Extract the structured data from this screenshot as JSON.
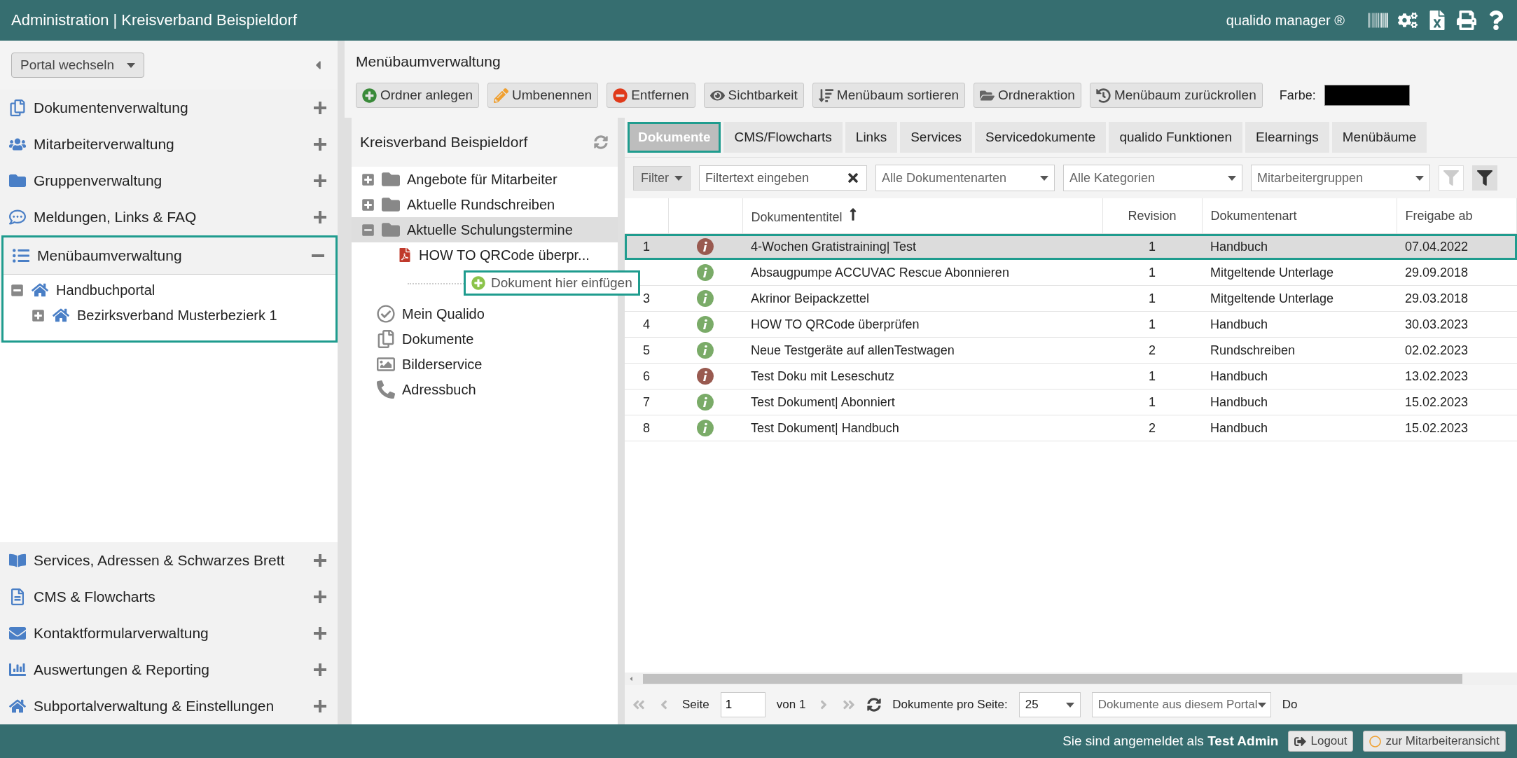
{
  "header": {
    "title": "Administration | Kreisverband Beispieldorf",
    "product": "qualido manager ®"
  },
  "sidebar": {
    "portal_button": "Portal wechseln",
    "items": [
      {
        "label": "Dokumentenverwaltung",
        "expanded": false
      },
      {
        "label": "Mitarbeiterverwaltung",
        "expanded": false
      },
      {
        "label": "Gruppenverwaltung",
        "expanded": false
      },
      {
        "label": "Meldungen, Links & FAQ",
        "expanded": false
      },
      {
        "label": "Menübaumverwaltung",
        "expanded": true,
        "children": [
          {
            "label": "Handbuchportal",
            "expanded": true,
            "children": [
              {
                "label": "Bezirksverband Musterbezierk 1",
                "expanded": false
              }
            ]
          }
        ]
      }
    ],
    "bottom_items": [
      {
        "label": "Services, Adressen & Schwarzes Brett",
        "expanded": false
      },
      {
        "label": "CMS & Flowcharts",
        "expanded": false
      },
      {
        "label": "Kontaktformularverwaltung",
        "expanded": false
      },
      {
        "label": "Auswertungen & Reporting",
        "expanded": false
      },
      {
        "label": "Subportalverwaltung & Einstellungen",
        "expanded": false
      }
    ]
  },
  "page_title": "Menübaumverwaltung",
  "toolbar": [
    {
      "label": "Ordner anlegen",
      "kind": "add"
    },
    {
      "label": "Umbenennen",
      "kind": "rename"
    },
    {
      "label": "Entfernen",
      "kind": "remove"
    },
    {
      "label": "Sichtbarkeit",
      "kind": "eye"
    },
    {
      "label": "Menübaum sortieren",
      "kind": "sort"
    },
    {
      "label": "Ordneraktion",
      "kind": "folder"
    },
    {
      "label": "Menübaum zurückrollen",
      "kind": "history"
    }
  ],
  "color_field": {
    "label": "Farbe:",
    "color": "#000000"
  },
  "tree": {
    "title": "Kreisverband Beispieldorf",
    "folders": [
      {
        "label": "Angebote für Mitarbeiter",
        "expanded": false,
        "selected": false
      },
      {
        "label": "Aktuelle Rundschreiben",
        "expanded": false,
        "selected": false
      },
      {
        "label": "Aktuelle Schulungstermine",
        "expanded": true,
        "selected": true,
        "children": [
          {
            "label": "HOW TO QRCode überpr..."
          }
        ]
      }
    ],
    "links": [
      {
        "label": "Mein Qualido"
      },
      {
        "label": "Dokumente"
      },
      {
        "label": "Bilderservice"
      },
      {
        "label": "Adressbuch"
      }
    ],
    "drop_hint": "Dokument hier einfügen"
  },
  "tabs": [
    {
      "label": "Dokumente",
      "selected": true
    },
    {
      "label": "CMS/Flowcharts",
      "selected": false
    },
    {
      "label": "Links",
      "selected": false
    },
    {
      "label": "Services",
      "selected": false
    },
    {
      "label": "Servicedokumente",
      "selected": false
    },
    {
      "label": "qualido Funktionen",
      "selected": false
    },
    {
      "label": "Elearnings",
      "selected": false
    },
    {
      "label": "Menübäume",
      "selected": false
    }
  ],
  "filters": {
    "button": "Filter",
    "text_placeholder": "Filtertext eingeben",
    "selects": [
      "Alle Dokumentenarten",
      "Alle Kategorien",
      "Mitarbeitergruppen"
    ]
  },
  "table": {
    "columns": [
      "Dokumententitel",
      "Revision",
      "Dokumentenart",
      "Freigabe ab"
    ],
    "rows": [
      {
        "num": "1",
        "color": "#995a50",
        "title": "4-Wochen Gratistraining| Test",
        "revision": "1",
        "type": "Handbuch",
        "date": "07.04.2022",
        "selected": true
      },
      {
        "color": "#7aab68",
        "title": "Absaugpumpe ACCUVAC Rescue Abonnieren",
        "revision": "1",
        "type": "Mitgeltende Unterlage",
        "date": "29.09.2018",
        "selected": false
      },
      {
        "num": "3",
        "color": "#7aab68",
        "title": "Akrinor Beipackzettel",
        "revision": "1",
        "type": "Mitgeltende Unterlage",
        "date": "29.03.2018",
        "selected": false
      },
      {
        "num": "4",
        "color": "#7aab68",
        "title": "HOW TO QRCode überprüfen",
        "revision": "1",
        "type": "Handbuch",
        "date": "30.03.2023",
        "selected": false
      },
      {
        "num": "5",
        "color": "#7aab68",
        "title": "Neue Testgeräte auf allenTestwagen",
        "revision": "2",
        "type": "Rundschreiben",
        "date": "02.02.2023",
        "selected": false
      },
      {
        "num": "6",
        "color": "#995a50",
        "title": "Test Doku mit Leseschutz",
        "revision": "1",
        "type": "Handbuch",
        "date": "13.02.2023",
        "selected": false
      },
      {
        "num": "7",
        "color": "#7aab68",
        "title": "Test Dokument| Abonniert",
        "revision": "1",
        "type": "Handbuch",
        "date": "15.02.2023",
        "selected": false
      },
      {
        "num": "8",
        "color": "#7aab68",
        "title": "Test Dokument| Handbuch",
        "revision": "2",
        "type": "Handbuch",
        "date": "15.02.2023",
        "selected": false
      }
    ]
  },
  "pager": {
    "page_label": "Seite",
    "page": "1",
    "of": "von 1",
    "per_page_label": "Dokumente pro Seite:",
    "per_page": "25",
    "scope": "Dokumente aus diesem Portal",
    "cut": "Do"
  },
  "footer": {
    "login_text": "Sie sind angemeldet als **Test Admin**",
    "buttons": [
      "Logout",
      "zur Mitarbeiteransicht"
    ]
  }
}
